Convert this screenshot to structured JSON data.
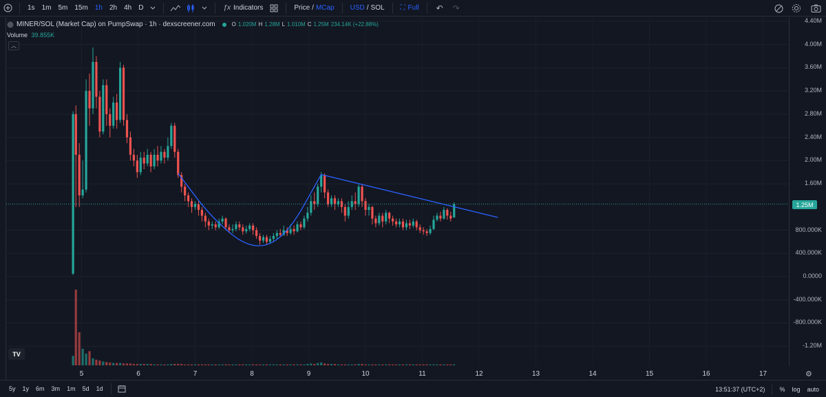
{
  "toolbar": {
    "timeframes": [
      "1s",
      "1m",
      "5m",
      "15m",
      "1h",
      "2h",
      "4h",
      "D"
    ],
    "active_timeframe": "1h",
    "indicators_label": "Indicators",
    "price_label": "Price",
    "slash": "/",
    "mcap_label": "MCap",
    "usd_label": "USD",
    "sol_label": "SOL",
    "full_label": "Full"
  },
  "legend": {
    "symbol": "MINER/SOL (Market Cap) on PumpSwap · 1h · dexscreener.com",
    "o_key": "O",
    "o_val": "1.020M",
    "h_key": "H",
    "h_val": "1.28M",
    "l_key": "L",
    "l_val": "1.010M",
    "c_key": "C",
    "c_val": "1.25M",
    "change": "234.14K (+22.88%)",
    "volume_label": "Volume",
    "volume_value": "39.855K"
  },
  "price_axis": {
    "labels": [
      "4.40M",
      "4.00M",
      "3.60M",
      "3.20M",
      "2.80M",
      "2.40M",
      "2.00M",
      "1.60M",
      "800.000K",
      "400.000K",
      "0.0000",
      "-400.000K",
      "-800.000K",
      "-1.20M"
    ],
    "current_price": "1.25M"
  },
  "time_axis": {
    "labels": [
      "5",
      "6",
      "7",
      "8",
      "9",
      "10",
      "11",
      "12",
      "13",
      "14",
      "15",
      "16",
      "17"
    ]
  },
  "bottom_bar": {
    "ranges": [
      "5y",
      "1y",
      "6m",
      "3m",
      "1m",
      "5d",
      "1d"
    ],
    "clock": "13:51:37 (UTC+2)",
    "percent": "%",
    "log": "log",
    "auto": "auto"
  },
  "colors": {
    "background": "#131722",
    "up": "#26a69a",
    "down": "#ef5350",
    "trendline": "#2962ff",
    "accent": "#2962ff"
  },
  "chart_data": {
    "type": "candlestick",
    "xlabel": "",
    "ylabel": "",
    "ylim": [
      -1400000,
      4500000
    ],
    "candles": [
      [
        4.85,
        0.05,
        2.8,
        0.03,
        2.85
      ],
      [
        4.9,
        2.8,
        2.1,
        1.2,
        2.95
      ],
      [
        4.96,
        2.1,
        1.4,
        1.2,
        2.3
      ],
      [
        5.02,
        1.4,
        1.5,
        1.35,
        2.0
      ],
      [
        5.08,
        1.5,
        3.2,
        1.45,
        3.4
      ],
      [
        5.14,
        3.2,
        2.9,
        2.6,
        3.5
      ],
      [
        5.2,
        2.9,
        3.7,
        2.8,
        3.95
      ],
      [
        5.26,
        3.7,
        3.1,
        2.9,
        3.8
      ],
      [
        5.32,
        3.1,
        2.5,
        2.4,
        3.2
      ],
      [
        5.38,
        2.5,
        3.3,
        2.45,
        3.4
      ],
      [
        5.44,
        3.3,
        2.8,
        2.6,
        3.4
      ],
      [
        5.5,
        2.8,
        2.6,
        2.4,
        2.9
      ],
      [
        5.56,
        2.6,
        3.0,
        2.55,
        3.1
      ],
      [
        5.62,
        3.0,
        2.7,
        2.55,
        3.15
      ],
      [
        5.68,
        2.7,
        3.6,
        2.65,
        3.7
      ],
      [
        5.74,
        3.6,
        2.7,
        2.6,
        3.65
      ],
      [
        5.8,
        2.7,
        2.4,
        2.3,
        2.8
      ],
      [
        5.86,
        2.4,
        2.1,
        2.0,
        2.5
      ],
      [
        5.92,
        2.1,
        2.0,
        1.9,
        2.2
      ],
      [
        5.98,
        2.0,
        1.8,
        1.7,
        2.1
      ],
      [
        6.04,
        1.8,
        2.05,
        1.75,
        2.15
      ],
      [
        6.1,
        2.05,
        1.95,
        1.85,
        2.15
      ],
      [
        6.16,
        1.95,
        2.1,
        1.9,
        2.2
      ],
      [
        6.22,
        2.1,
        1.9,
        1.8,
        2.15
      ],
      [
        6.28,
        1.9,
        2.1,
        1.85,
        2.2
      ],
      [
        6.34,
        2.1,
        2.0,
        1.9,
        2.25
      ],
      [
        6.4,
        2.0,
        2.15,
        1.95,
        2.25
      ],
      [
        6.46,
        2.15,
        2.05,
        1.95,
        2.2
      ],
      [
        6.52,
        2.05,
        2.25,
        2.0,
        2.4
      ],
      [
        6.58,
        2.25,
        2.6,
        2.2,
        2.65
      ],
      [
        6.64,
        2.6,
        2.15,
        2.05,
        2.65
      ],
      [
        6.7,
        2.15,
        1.75,
        1.7,
        2.2
      ],
      [
        6.76,
        1.75,
        1.55,
        1.45,
        1.8
      ],
      [
        6.82,
        1.55,
        1.4,
        1.3,
        1.6
      ],
      [
        6.88,
        1.4,
        1.3,
        1.2,
        1.45
      ],
      [
        6.94,
        1.3,
        1.2,
        1.1,
        1.35
      ],
      [
        7.0,
        1.2,
        1.25,
        1.15,
        1.3
      ],
      [
        7.06,
        1.25,
        1.15,
        1.05,
        1.3
      ],
      [
        7.12,
        1.15,
        1.05,
        0.95,
        1.2
      ],
      [
        7.18,
        1.05,
        0.95,
        0.85,
        1.1
      ],
      [
        7.24,
        0.95,
        0.88,
        0.8,
        1.0
      ],
      [
        7.3,
        0.88,
        0.9,
        0.82,
        0.95
      ],
      [
        7.36,
        0.9,
        0.85,
        0.8,
        0.95
      ],
      [
        7.42,
        0.85,
        0.95,
        0.82,
        1.0
      ],
      [
        7.48,
        0.95,
        1.0,
        0.9,
        1.05
      ],
      [
        7.54,
        1.0,
        0.85,
        0.8,
        1.02
      ],
      [
        7.6,
        0.85,
        0.8,
        0.75,
        0.9
      ],
      [
        7.66,
        0.8,
        0.82,
        0.75,
        0.9
      ],
      [
        7.72,
        0.82,
        0.9,
        0.78,
        0.95
      ],
      [
        7.78,
        0.9,
        0.85,
        0.8,
        0.95
      ],
      [
        7.84,
        0.85,
        0.78,
        0.72,
        0.9
      ],
      [
        7.9,
        0.78,
        0.82,
        0.74,
        0.88
      ],
      [
        7.96,
        0.82,
        0.88,
        0.78,
        0.92
      ],
      [
        8.02,
        0.88,
        0.8,
        0.72,
        0.92
      ],
      [
        8.08,
        0.8,
        0.7,
        0.65,
        0.85
      ],
      [
        8.14,
        0.7,
        0.62,
        0.55,
        0.75
      ],
      [
        8.2,
        0.62,
        0.68,
        0.58,
        0.72
      ],
      [
        8.26,
        0.68,
        0.6,
        0.55,
        0.72
      ],
      [
        8.32,
        0.6,
        0.65,
        0.58,
        0.7
      ],
      [
        8.38,
        0.65,
        0.7,
        0.6,
        0.75
      ],
      [
        8.44,
        0.7,
        0.75,
        0.65,
        0.8
      ],
      [
        8.5,
        0.75,
        0.72,
        0.68,
        0.82
      ],
      [
        8.56,
        0.72,
        0.8,
        0.7,
        0.88
      ],
      [
        8.62,
        0.8,
        0.75,
        0.7,
        0.85
      ],
      [
        8.68,
        0.75,
        0.82,
        0.72,
        0.9
      ],
      [
        8.74,
        0.82,
        0.78,
        0.72,
        0.88
      ],
      [
        8.8,
        0.78,
        0.9,
        0.76,
        0.95
      ],
      [
        8.86,
        0.9,
        0.85,
        0.8,
        0.95
      ],
      [
        8.92,
        0.85,
        1.0,
        0.82,
        1.05
      ],
      [
        8.98,
        1.0,
        1.1,
        0.95,
        1.2
      ],
      [
        9.04,
        1.1,
        1.3,
        1.05,
        1.4
      ],
      [
        9.1,
        1.3,
        1.25,
        1.15,
        1.45
      ],
      [
        9.16,
        1.25,
        1.55,
        1.2,
        1.6
      ],
      [
        9.22,
        1.55,
        1.75,
        1.45,
        1.8
      ],
      [
        9.28,
        1.75,
        1.45,
        1.35,
        1.78
      ],
      [
        9.34,
        1.45,
        1.25,
        1.2,
        1.5
      ],
      [
        9.4,
        1.25,
        1.35,
        1.2,
        1.4
      ],
      [
        9.46,
        1.35,
        1.25,
        1.15,
        1.4
      ],
      [
        9.52,
        1.25,
        1.3,
        1.2,
        1.35
      ],
      [
        9.58,
        1.3,
        1.2,
        1.1,
        1.35
      ],
      [
        9.64,
        1.2,
        1.05,
        0.95,
        1.25
      ],
      [
        9.7,
        1.05,
        1.2,
        1.0,
        1.3
      ],
      [
        9.76,
        1.2,
        1.3,
        1.15,
        1.4
      ],
      [
        9.82,
        1.3,
        1.25,
        1.15,
        1.45
      ],
      [
        9.88,
        1.25,
        1.55,
        1.2,
        1.6
      ],
      [
        9.94,
        1.55,
        1.3,
        1.2,
        1.6
      ],
      [
        10.0,
        1.3,
        1.15,
        1.05,
        1.35
      ],
      [
        10.06,
        1.15,
        1.2,
        1.05,
        1.25
      ],
      [
        10.12,
        1.2,
        1.0,
        0.9,
        1.22
      ],
      [
        10.18,
        1.0,
        0.92,
        0.85,
        1.05
      ],
      [
        10.24,
        0.92,
        1.05,
        0.88,
        1.1
      ],
      [
        10.3,
        1.05,
        0.95,
        0.85,
        1.1
      ],
      [
        10.36,
        0.95,
        1.1,
        0.9,
        1.15
      ],
      [
        10.42,
        1.1,
        1.0,
        0.92,
        1.12
      ],
      [
        10.48,
        1.0,
        0.95,
        0.88,
        1.05
      ],
      [
        10.54,
        0.95,
        0.9,
        0.85,
        1.0
      ],
      [
        10.6,
        0.9,
        0.95,
        0.85,
        1.0
      ],
      [
        10.66,
        0.95,
        0.85,
        0.8,
        1.0
      ],
      [
        10.72,
        0.85,
        0.92,
        0.8,
        0.98
      ],
      [
        10.78,
        0.92,
        0.88,
        0.82,
        0.98
      ],
      [
        10.84,
        0.88,
        0.95,
        0.84,
        1.0
      ],
      [
        10.9,
        0.95,
        0.85,
        0.8,
        0.98
      ],
      [
        10.96,
        0.85,
        0.8,
        0.75,
        0.9
      ],
      [
        11.02,
        0.8,
        0.78,
        0.72,
        0.85
      ],
      [
        11.08,
        0.78,
        0.75,
        0.7,
        0.82
      ],
      [
        11.14,
        0.75,
        0.82,
        0.72,
        0.88
      ],
      [
        11.2,
        0.82,
        0.98,
        0.8,
        1.05
      ],
      [
        11.26,
        0.98,
        1.05,
        0.95,
        1.1
      ],
      [
        11.32,
        1.05,
        1.0,
        0.95,
        1.12
      ],
      [
        11.38,
        1.0,
        1.15,
        0.98,
        1.2
      ],
      [
        11.44,
        1.15,
        1.05,
        0.98,
        1.18
      ],
      [
        11.5,
        1.05,
        1.0,
        0.95,
        1.12
      ],
      [
        11.56,
        1.02,
        1.25,
        1.01,
        1.28
      ]
    ],
    "volume": [
      0.2,
      1.6,
      0.7,
      0.35,
      0.25,
      0.3,
      0.15,
      0.12,
      0.1,
      0.08,
      0.07,
      0.06,
      0.05,
      0.05,
      0.05,
      0.04,
      0.04,
      0.04,
      0.03,
      0.03,
      0.03,
      0.03,
      0.03,
      0.03,
      0.02,
      0.02,
      0.02,
      0.02,
      0.02,
      0.03,
      0.03,
      0.03,
      0.03,
      0.02,
      0.02,
      0.02,
      0.02,
      0.02,
      0.02,
      0.02,
      0.02,
      0.02,
      0.02,
      0.02,
      0.02,
      0.02,
      0.02,
      0.02,
      0.02,
      0.02,
      0.02,
      0.02,
      0.02,
      0.02,
      0.02,
      0.02,
      0.02,
      0.02,
      0.02,
      0.02,
      0.02,
      0.02,
      0.02,
      0.02,
      0.02,
      0.02,
      0.02,
      0.02,
      0.02,
      0.03,
      0.04,
      0.03,
      0.05,
      0.06,
      0.04,
      0.03,
      0.03,
      0.03,
      0.02,
      0.02,
      0.02,
      0.02,
      0.02,
      0.02,
      0.03,
      0.03,
      0.02,
      0.02,
      0.02,
      0.02,
      0.02,
      0.02,
      0.02,
      0.02,
      0.02,
      0.02,
      0.02,
      0.02,
      0.02,
      0.02,
      0.02,
      0.02,
      0.02,
      0.02,
      0.02,
      0.02,
      0.02,
      0.02,
      0.02,
      0.02,
      0.02,
      0.02,
      0.02
    ],
    "annotations": [
      {
        "type": "trendline",
        "from": [
          9.22,
          1.76
        ],
        "to": [
          12.33,
          1.02
        ]
      },
      {
        "type": "curve",
        "points": [
          [
            6.7,
            1.78
          ],
          [
            7.3,
            1.0
          ],
          [
            8.0,
            0.45
          ],
          [
            8.6,
            0.68
          ],
          [
            9.22,
            1.76
          ]
        ]
      }
    ],
    "current_price": 1.25
  }
}
